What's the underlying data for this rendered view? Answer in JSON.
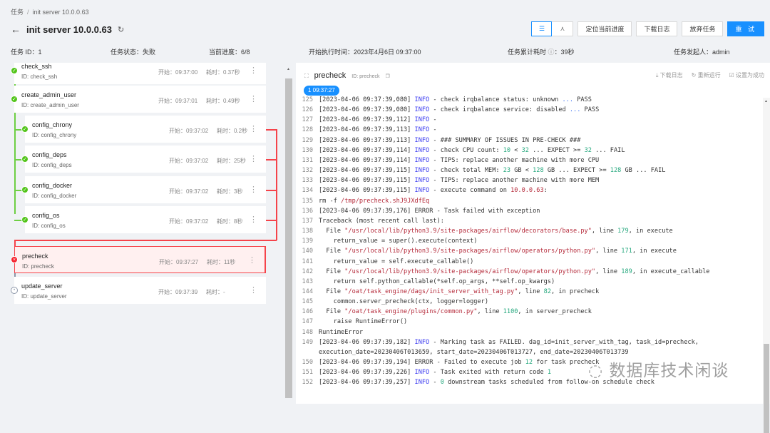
{
  "breadcrumb": {
    "root": "任务",
    "separator": "/",
    "current": "init server 10.0.0.63"
  },
  "header": {
    "title": "init server 10.0.0.63",
    "buttons": {
      "locate": "定位当前进度",
      "download": "下载日志",
      "abandon": "放弃任务",
      "retry": "重 试"
    },
    "view_icons": [
      "list-view-icon",
      "graph-view-icon"
    ]
  },
  "meta": {
    "task_id": "任务 ID：1",
    "status": "任务状态：失败",
    "progress": "当前进度：6/8",
    "start_time": "开始执行时间：2023年4月6日 09:37:00",
    "total_time_label": "任务累计耗时",
    "total_time_value": "：39秒",
    "initiator": "任务发起人：admin"
  },
  "tasks": [
    {
      "name": "check_ssh",
      "id": "ID: check_ssh",
      "start": "开始：09:37:00",
      "duration": "耗时：0.37秒",
      "status": "success"
    },
    {
      "name": "create_admin_user",
      "id": "ID: create_admin_user",
      "start": "开始：09:37:01",
      "duration": "耗时：0.49秒",
      "status": "success"
    },
    {
      "name": "config_chrony",
      "id": "ID: config_chrony",
      "start": "开始：09:37:02",
      "duration": "耗时：0.2秒",
      "status": "success"
    },
    {
      "name": "config_deps",
      "id": "ID: config_deps",
      "start": "开始：09:37:02",
      "duration": "耗时：25秒",
      "status": "success"
    },
    {
      "name": "config_docker",
      "id": "ID: config_docker",
      "start": "开始：09:37:02",
      "duration": "耗时：3秒",
      "status": "success"
    },
    {
      "name": "config_os",
      "id": "ID: config_os",
      "start": "开始：09:37:02",
      "duration": "耗时：8秒",
      "status": "success"
    },
    {
      "name": "precheck",
      "id": "ID: precheck",
      "start": "开始：09:37:27",
      "duration": "耗时：11秒",
      "status": "failed"
    },
    {
      "name": "update_server",
      "id": "ID: update_server",
      "start": "开始：09:37:39",
      "duration": "耗时：-",
      "status": "pending"
    }
  ],
  "detail": {
    "name": "precheck",
    "id": "ID: precheck",
    "actions": {
      "download": "下载日志",
      "rerun": "重新运行",
      "set_success": "设置为成功"
    },
    "attempt": "1 09:37:27"
  },
  "colors": {
    "primary": "#1890ff",
    "success": "#52c41a",
    "error": "#f5222d"
  },
  "log": [
    [
      125,
      [
        [
          "[2023-04-06 09:37:39,080] ",
          ""
        ],
        [
          "INFO",
          "info"
        ],
        [
          " - check irqbalance status: unknown ",
          ""
        ],
        [
          "...",
          "dots"
        ],
        [
          " PASS",
          ""
        ]
      ]
    ],
    [
      126,
      [
        [
          "[2023-04-06 09:37:39,080] ",
          ""
        ],
        [
          "INFO",
          "info"
        ],
        [
          " - check irqbalance service: disabled ",
          ""
        ],
        [
          "...",
          "dots"
        ],
        [
          " PASS",
          ""
        ]
      ]
    ],
    [
      127,
      [
        [
          "[2023-04-06 09:37:39,112] ",
          ""
        ],
        [
          "INFO",
          "info"
        ],
        [
          " -",
          ""
        ]
      ]
    ],
    [
      128,
      [
        [
          "[2023-04-06 09:37:39,113] ",
          ""
        ],
        [
          "INFO",
          "info"
        ],
        [
          " -",
          ""
        ]
      ]
    ],
    [
      129,
      [
        [
          "[2023-04-06 09:37:39,113] ",
          ""
        ],
        [
          "INFO",
          "info"
        ],
        [
          " - ### SUMMARY OF ISSUES IN PRE-CHECK ###",
          ""
        ]
      ]
    ],
    [
      130,
      [
        [
          "[2023-04-06 09:37:39,114] ",
          ""
        ],
        [
          "INFO",
          "info"
        ],
        [
          " - check CPU count: ",
          ""
        ],
        [
          "10",
          "num"
        ],
        [
          " < ",
          ""
        ],
        [
          "32",
          "num"
        ],
        [
          " ... EXPECT >= ",
          ""
        ],
        [
          "32",
          "num"
        ],
        [
          " ... FAIL",
          ""
        ]
      ]
    ],
    [
      131,
      [
        [
          "[2023-04-06 09:37:39,114] ",
          ""
        ],
        [
          "INFO",
          "info"
        ],
        [
          " - TIPS: replace another machine with more CPU",
          ""
        ]
      ]
    ],
    [
      132,
      [
        [
          "[2023-04-06 09:37:39,115] ",
          ""
        ],
        [
          "INFO",
          "info"
        ],
        [
          " - check total MEM: ",
          ""
        ],
        [
          "23",
          "num"
        ],
        [
          " GB < ",
          ""
        ],
        [
          "128",
          "num"
        ],
        [
          " GB ... EXPECT >= ",
          ""
        ],
        [
          "128",
          "num"
        ],
        [
          " GB ... FAIL",
          ""
        ]
      ]
    ],
    [
      133,
      [
        [
          "[2023-04-06 09:37:39,115] ",
          ""
        ],
        [
          "INFO",
          "info"
        ],
        [
          " - TIPS: replace another machine with more MEM",
          ""
        ]
      ]
    ],
    [
      134,
      [
        [
          "[2023-04-06 09:37:39,115] ",
          ""
        ],
        [
          "INFO",
          "info"
        ],
        [
          " - execute command on ",
          ""
        ],
        [
          "10.0.0.63",
          "str"
        ],
        [
          ":",
          ""
        ]
      ]
    ],
    [
      135,
      [
        [
          "rm -f ",
          ""
        ],
        [
          "/tmp/precheck.shJ9JXdfEq",
          "str"
        ]
      ]
    ],
    [
      136,
      [
        [
          "[2023-04-06 09:37:39,176] ERROR - Task failed with exception",
          ""
        ]
      ]
    ],
    [
      137,
      [
        [
          "Traceback (most recent call last):",
          ""
        ]
      ]
    ],
    [
      138,
      [
        [
          "  File ",
          ""
        ],
        [
          "\"/usr/local/lib/python3.9/site-packages/airflow/decorators/base.py\"",
          "str"
        ],
        [
          ", line ",
          ""
        ],
        [
          "179",
          "num"
        ],
        [
          ", in execute",
          ""
        ]
      ]
    ],
    [
      139,
      [
        [
          "    return_value = super().execute(context)",
          ""
        ]
      ]
    ],
    [
      140,
      [
        [
          "  File ",
          ""
        ],
        [
          "\"/usr/local/lib/python3.9/site-packages/airflow/operators/python.py\"",
          "str"
        ],
        [
          ", line ",
          ""
        ],
        [
          "171",
          "num"
        ],
        [
          ", in execute",
          ""
        ]
      ]
    ],
    [
      141,
      [
        [
          "    return_value = self.execute_callable()",
          ""
        ]
      ]
    ],
    [
      142,
      [
        [
          "  File ",
          ""
        ],
        [
          "\"/usr/local/lib/python3.9/site-packages/airflow/operators/python.py\"",
          "str"
        ],
        [
          ", line ",
          ""
        ],
        [
          "189",
          "num"
        ],
        [
          ", in execute_callable",
          ""
        ]
      ]
    ],
    [
      143,
      [
        [
          "    return self.python_callable(*self.op_args, **self.op_kwargs)",
          ""
        ]
      ]
    ],
    [
      144,
      [
        [
          "  File ",
          ""
        ],
        [
          "\"/oat/task_engine/dags/init_server_with_tag.py\"",
          "str"
        ],
        [
          ", line ",
          ""
        ],
        [
          "82",
          "num"
        ],
        [
          ", in precheck",
          ""
        ]
      ]
    ],
    [
      145,
      [
        [
          "    common.server_precheck(ctx, logger=logger)",
          ""
        ]
      ]
    ],
    [
      146,
      [
        [
          "  File ",
          ""
        ],
        [
          "\"/oat/task_engine/plugins/common.py\"",
          "str"
        ],
        [
          ", line ",
          ""
        ],
        [
          "1100",
          "num"
        ],
        [
          ", in server_precheck",
          ""
        ]
      ]
    ],
    [
      147,
      [
        [
          "    raise RuntimeError()",
          ""
        ]
      ]
    ],
    [
      148,
      [
        [
          "RuntimeError",
          ""
        ]
      ]
    ],
    [
      149,
      [
        [
          "[2023-04-06 09:37:39,182] ",
          ""
        ],
        [
          "INFO",
          "info"
        ],
        [
          " - Marking task as FAILED. dag_id=init_server_with_tag, task_id=precheck, execution_date=20230406T013659, start_date=20230406T013727, end_date=20230406T013739",
          ""
        ]
      ]
    ],
    [
      150,
      [
        [
          "[2023-04-06 09:37:39,194] ERROR - Failed to execute job ",
          ""
        ],
        [
          "12",
          "num"
        ],
        [
          " for task precheck",
          ""
        ]
      ]
    ],
    [
      151,
      [
        [
          "[2023-04-06 09:37:39,226] ",
          ""
        ],
        [
          "INFO",
          "info"
        ],
        [
          " - Task exited with return code ",
          ""
        ],
        [
          "1",
          "num"
        ]
      ]
    ],
    [
      152,
      [
        [
          "[2023-04-06 09:37:39,257] ",
          ""
        ],
        [
          "INFO",
          "info"
        ],
        [
          " - ",
          ""
        ],
        [
          "0",
          "num"
        ],
        [
          " downstream tasks scheduled from follow-on schedule check",
          ""
        ]
      ]
    ]
  ],
  "watermark": "数据库技术闲谈"
}
